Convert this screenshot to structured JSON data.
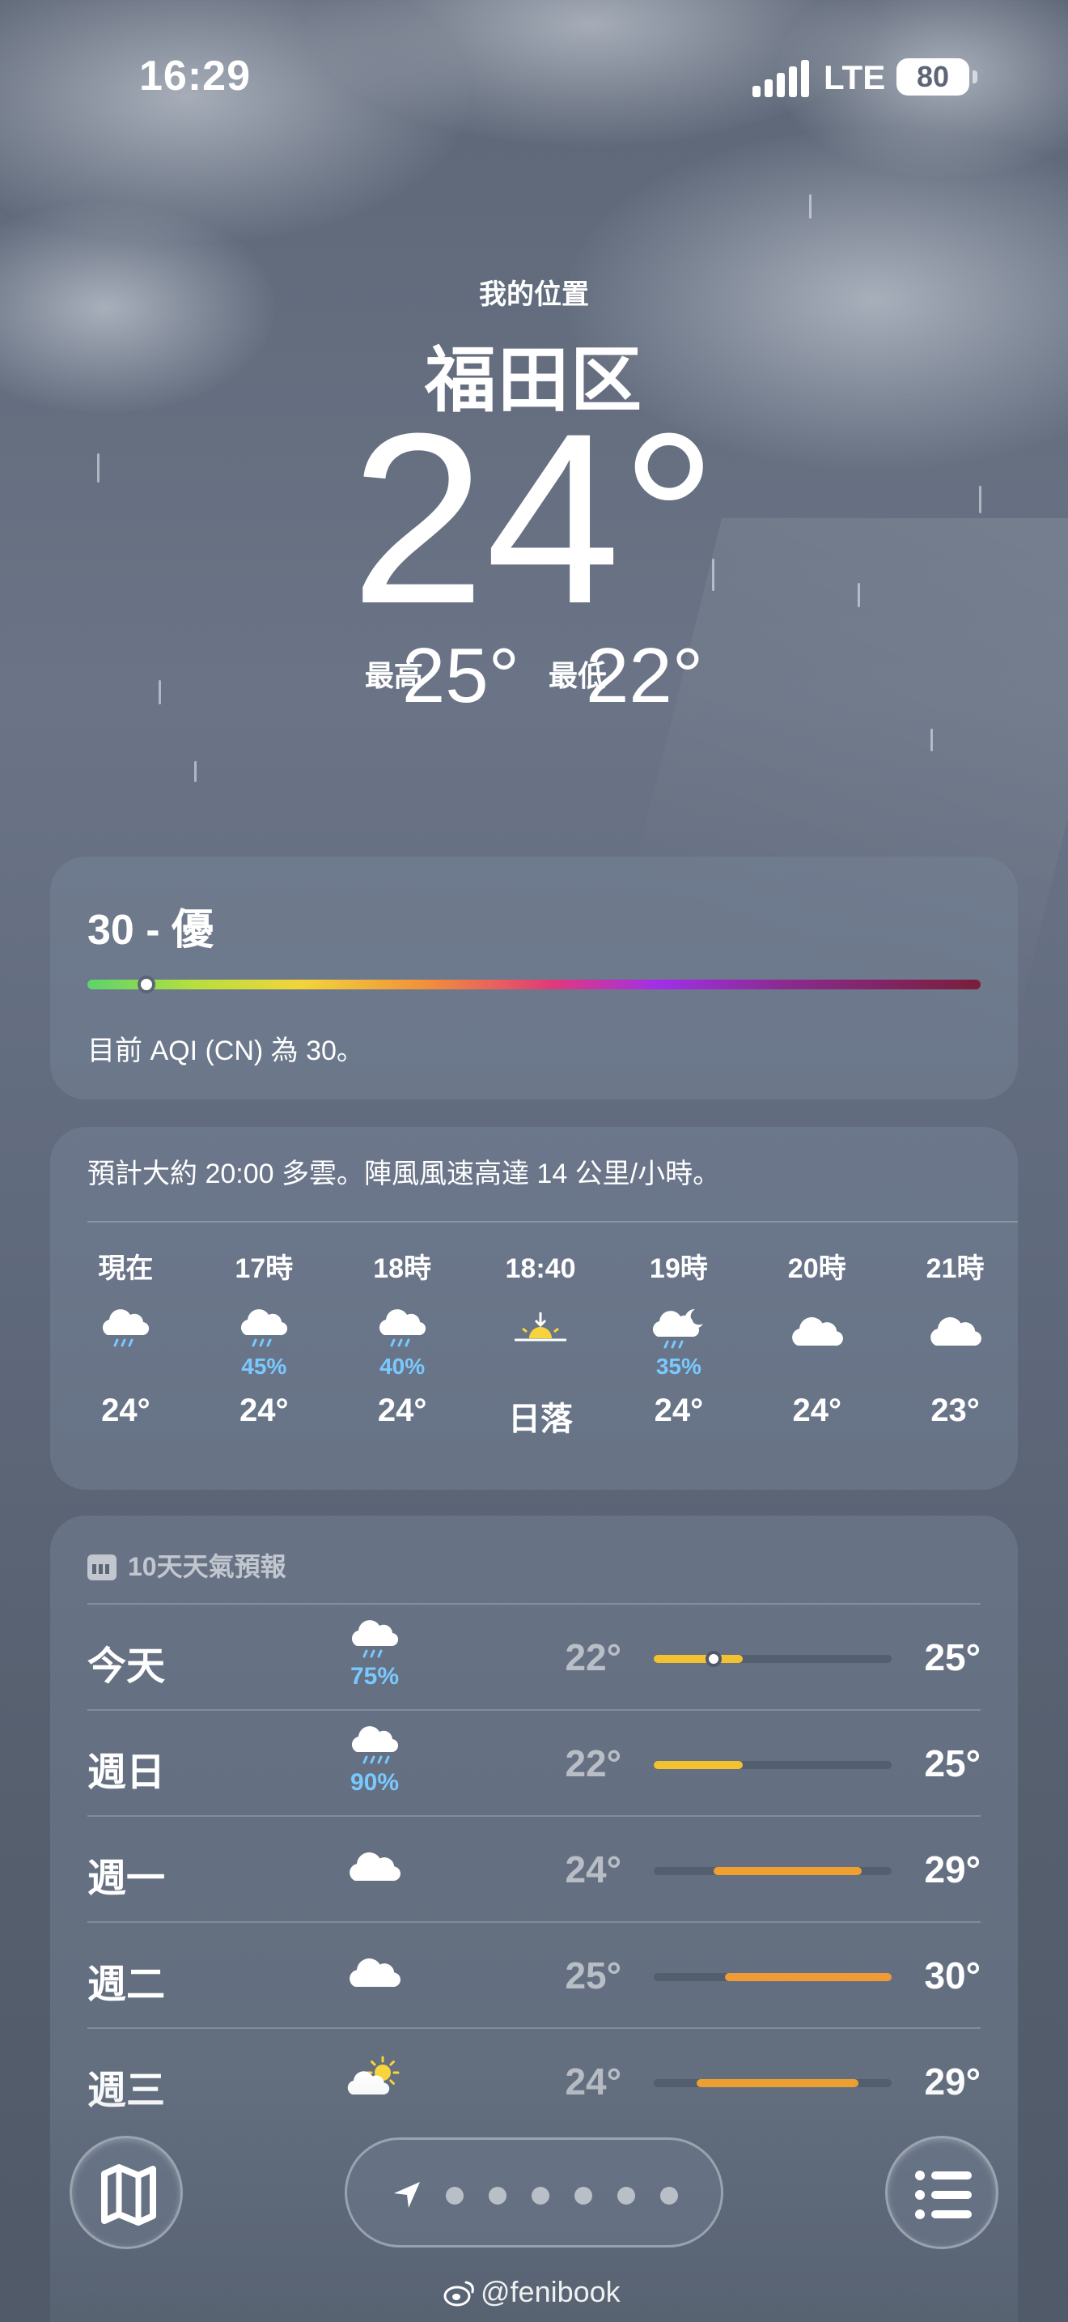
{
  "status_bar": {
    "time": "16:29",
    "network": "LTE",
    "battery": "80"
  },
  "header": {
    "location_label": "我的位置",
    "city": "福田区",
    "temperature": "24°",
    "high_label": "最高",
    "high": "25°",
    "low_label": "最低",
    "low": "22°"
  },
  "aqi": {
    "title": "30 - 優",
    "description": "目前 AQI (CN) 為 30。",
    "value_fraction": 0.066
  },
  "hourly": {
    "summary": "預計大約 20:00 多雲。陣風風速高達 14 公里/小時。",
    "items": [
      {
        "label": "現在",
        "icon": "rain-cloud-icon",
        "precip": "",
        "value": "24°"
      },
      {
        "label": "17時",
        "icon": "rain-cloud-icon",
        "precip": "45%",
        "value": "24°"
      },
      {
        "label": "18時",
        "icon": "rain-cloud-icon",
        "precip": "40%",
        "value": "24°"
      },
      {
        "label": "18:40",
        "icon": "sunset-icon",
        "precip": "",
        "value": "日落"
      },
      {
        "label": "19時",
        "icon": "night-rain-icon",
        "precip": "35%",
        "value": "24°"
      },
      {
        "label": "20時",
        "icon": "cloud-icon",
        "precip": "",
        "value": "24°"
      },
      {
        "label": "21時",
        "icon": "cloud-icon",
        "precip": "",
        "value": "23°"
      }
    ]
  },
  "daily": {
    "title": "10天天氣預報",
    "days": [
      {
        "name": "今天",
        "icon": "rain-cloud-icon",
        "precip": "75%",
        "low": "22°",
        "high": "25°",
        "range_start": 0.0,
        "range_end": 0.375,
        "current": 0.25,
        "color": "#f2c230"
      },
      {
        "name": "週日",
        "icon": "heavy-rain-icon",
        "precip": "90%",
        "low": "22°",
        "high": "25°",
        "range_start": 0.0,
        "range_end": 0.375,
        "color": "#f2c230"
      },
      {
        "name": "週一",
        "icon": "cloud-icon",
        "precip": "",
        "low": "24°",
        "high": "29°",
        "range_start": 0.25,
        "range_end": 0.875,
        "color": "#f0a030"
      },
      {
        "name": "週二",
        "icon": "cloud-icon",
        "precip": "",
        "low": "25°",
        "high": "30°",
        "range_start": 0.3,
        "range_end": 1.0,
        "color": "#f09a38"
      },
      {
        "name": "週三",
        "icon": "partly-sunny-icon",
        "precip": "",
        "low": "24°",
        "high": "29°",
        "range_start": 0.18,
        "range_end": 0.86,
        "color": "#f0a030"
      }
    ]
  },
  "toolbar": {
    "page_count": 6
  },
  "watermark": "@fenibook"
}
